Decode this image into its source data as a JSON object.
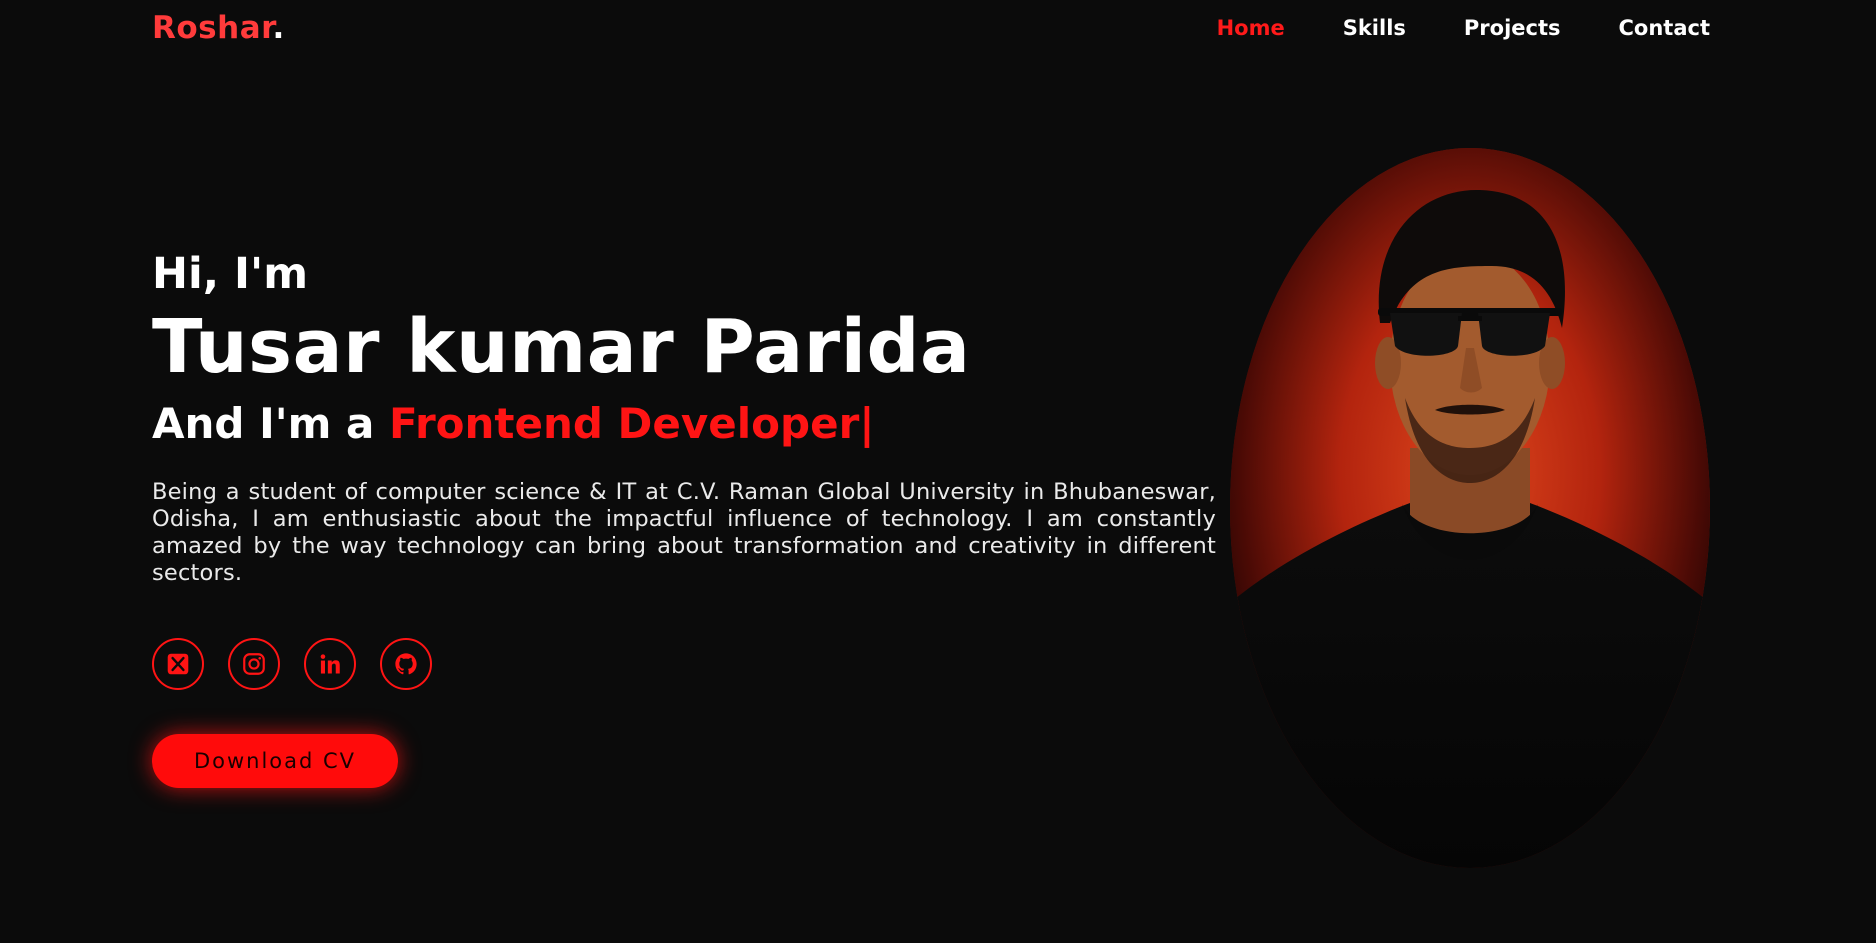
{
  "header": {
    "logo_name": "Roshar",
    "logo_dot": ".",
    "nav": [
      {
        "label": "Home",
        "active": true
      },
      {
        "label": "Skills",
        "active": false
      },
      {
        "label": "Projects",
        "active": false
      },
      {
        "label": "Contact",
        "active": false
      }
    ]
  },
  "hero": {
    "greeting": "Hi, I'm",
    "name": "Tusar kumar Parida",
    "role_prefix": "And I'm a ",
    "role_accent": "Frontend Developer",
    "cursor": "|",
    "bio": "Being a student of computer science & IT at C.V. Raman Global University in Bhubaneswar, Odisha, I am enthusiastic about the impactful influence of technology. I am constantly amazed by the way technology can bring about transformation and creativity in different sectors."
  },
  "socials": [
    {
      "icon": "x-icon"
    },
    {
      "icon": "instagram-icon"
    },
    {
      "icon": "linkedin-icon"
    },
    {
      "icon": "github-icon"
    }
  ],
  "cta": {
    "download_label": "Download CV"
  },
  "colors": {
    "accent": "#ff1414",
    "logo": "#ff3b3b",
    "background": "#0b0b0b"
  }
}
